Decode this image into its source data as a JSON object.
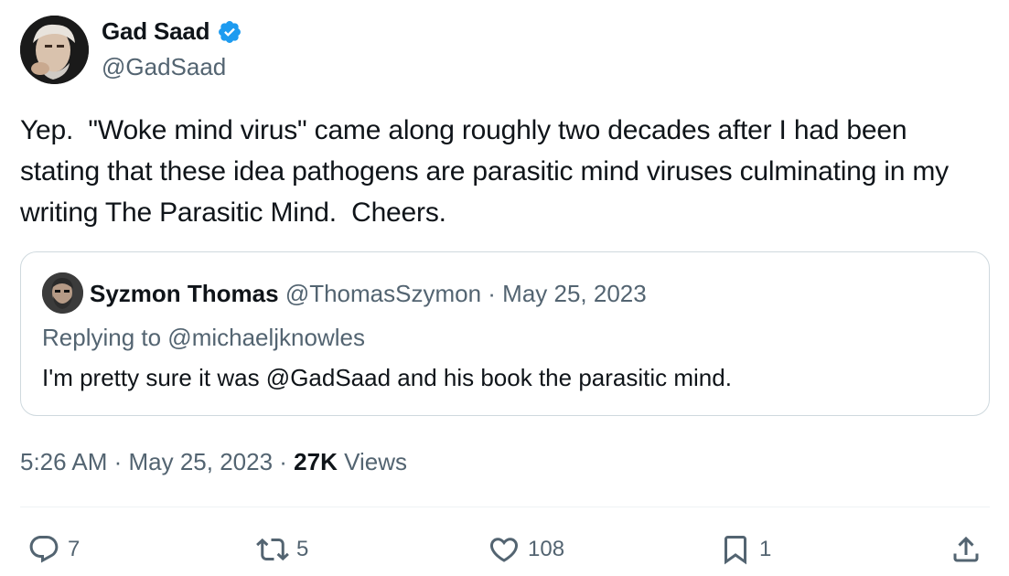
{
  "tweet": {
    "author": {
      "name": "Gad Saad",
      "handle": "@GadSaad"
    },
    "text": "Yep.  \"Woke mind virus\" came along roughly two decades after I had been stating that these idea pathogens are parasitic mind viruses culminating in my writing The Parasitic Mind.  Cheers.",
    "quoted": {
      "name": "Syzmon Thomas",
      "meta": " @ThomasSzymon · May 25, 2023",
      "replying_to": "Replying to @michaeljknowles",
      "text": "I'm pretty sure it was @GadSaad and his book the parasitic mind."
    },
    "time": "5:26 AM · May 25, 2023 · ",
    "views_count": "27K",
    "views_label": " Views",
    "actions": {
      "replies": "7",
      "reposts": "5",
      "likes": "108",
      "bookmarks": "1"
    }
  },
  "colors": {
    "verified": "#1d9bf0",
    "secondary_text": "#536471",
    "primary_text": "#0f1419",
    "border": "#cfd9de"
  }
}
